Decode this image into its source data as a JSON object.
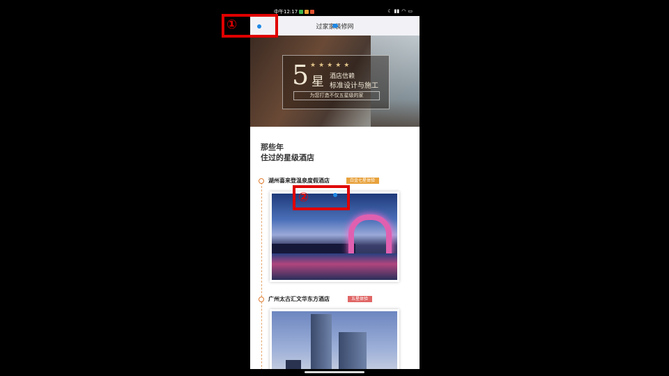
{
  "status_bar": {
    "time": "中午12:17",
    "right_icons": [
      "moon-icon",
      "signal-icon",
      "wifi-icon",
      "battery-icon"
    ]
  },
  "nav": {
    "title": "过家家装修网"
  },
  "hero": {
    "big_number": "5",
    "star_char": "星",
    "stars": "★★★★★",
    "line1": "酒店信赖",
    "line2": "标准设计与施工",
    "tagline": "为您打造不仅五星级的家"
  },
  "section": {
    "title_line1": "那些年",
    "title_line2": "住过的星级酒店"
  },
  "hotels": [
    {
      "name": "湖州喜来登温泉度假酒店",
      "badge": "白金七星体验"
    },
    {
      "name": "广州太古汇文华东方酒店",
      "badge": "五星体验"
    }
  ],
  "annotations": {
    "marker1": "①",
    "marker2": "②"
  },
  "colors": {
    "accent_blue": "#1e88e5",
    "marker_red": "#e00000",
    "timeline_orange": "#e07b2e",
    "badge_gold": "#e8a23c",
    "badge_red": "#e06666"
  }
}
